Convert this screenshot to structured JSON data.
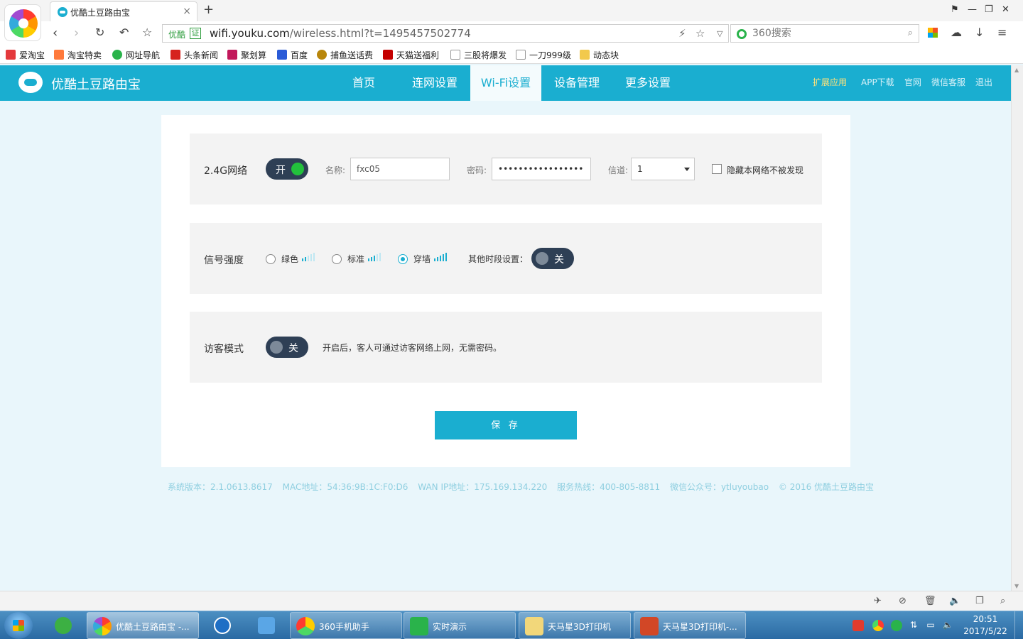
{
  "browser": {
    "tab_title": "优酷土豆路由宝",
    "tab_close": "×",
    "new_tab": "+",
    "win_controls": [
      "⚑",
      "—",
      "❐",
      "✕"
    ],
    "cert_label": "优酷",
    "cert_badge": "证",
    "url_host": "wifi.youku.com",
    "url_rest": "/wireless.html?t=1495457502774",
    "search_placeholder": "360搜索",
    "bookmarks": [
      "爱淘宝",
      "淘宝特卖",
      "网址导航",
      "头条新闻",
      "聚划算",
      "百度",
      "捕鱼送话费",
      "天猫送福利",
      "三股将爆发",
      "一刀999级",
      "动态块"
    ]
  },
  "app": {
    "brand": "优酷土豆路由宝",
    "nav": [
      "首页",
      "连网设置",
      "Wi-Fi设置",
      "设备管理",
      "更多设置"
    ],
    "active_nav": "Wi-Fi设置",
    "top_links": [
      "扩展应用",
      "APP下载",
      "官网",
      "微信客服",
      "退出"
    ]
  },
  "wifi_24g": {
    "title": "2.4G网络",
    "toggle_label": "开",
    "name_label": "名称:",
    "name_value": "fxc05",
    "password_label": "密码:",
    "password_value": "•••••••••••••••••••••••",
    "channel_label": "信道:",
    "channel_value": "1",
    "hide_label": "隐藏本网络不被发现"
  },
  "signal": {
    "title": "信号强度",
    "options": [
      "绿色",
      "标准",
      "穿墙"
    ],
    "levels": [
      2,
      3,
      5
    ],
    "selected": "穿墙",
    "other_time_label": "其他时段设置：",
    "toggle_label": "关"
  },
  "guest": {
    "title": "访客模式",
    "toggle_label": "关",
    "desc": "开启后，客人可通过访客网络上网，无需密码。"
  },
  "save_label": "保 存",
  "footer": {
    "version": "系统版本：2.1.0613.8617",
    "mac": "MAC地址：54:36:9B:1C:F0:D6",
    "wan_ip": "WAN IP地址：175.169.134.220",
    "hotline": "服务热线：400-805-8811",
    "wechat": "微信公众号：ytluyoubao",
    "copyright": "© 2016 优酷土豆路由宝"
  },
  "taskbar": {
    "tasks": [
      "优酷土豆路由宝 -...",
      "360手机助手",
      "实时演示",
      "天马星3D打印机",
      "天马星3D打印机-..."
    ],
    "time": "20:51",
    "date": "2017/5/22"
  },
  "colors": {
    "accent": "#1aaed0",
    "toggle_bg": "#2e3f55",
    "toggle_on": "#22c03c",
    "page_bg": "#e9f6fb"
  }
}
